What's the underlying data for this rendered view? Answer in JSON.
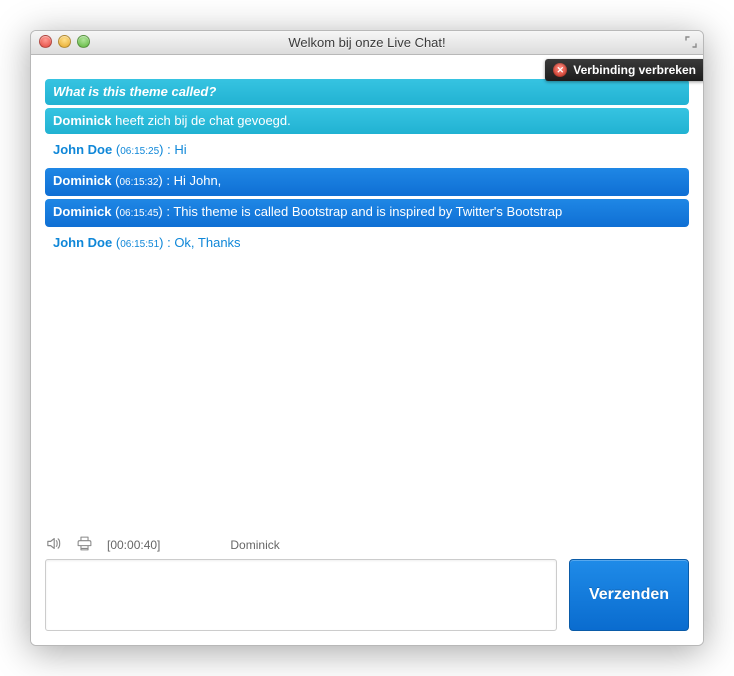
{
  "window": {
    "title": "Welkom bij onze Live Chat!"
  },
  "disconnect": {
    "label": "Verbinding verbreken"
  },
  "chat": {
    "question": "What is this theme called?",
    "joined": {
      "name": "Dominick",
      "rest": " heeft zich bij de chat gevoegd."
    },
    "messages": [
      {
        "kind": "visitor",
        "name": "John Doe",
        "time": "06:15:25",
        "text": "Hi"
      },
      {
        "kind": "agent",
        "name": "Dominick",
        "time": "06:15:32",
        "text": "Hi John,"
      },
      {
        "kind": "agent",
        "name": "Dominick",
        "time": "06:15:45",
        "text": "This theme is called Bootstrap and is inspired by Twitter's Bootstrap"
      },
      {
        "kind": "visitor",
        "name": "John Doe",
        "time": "06:15:51",
        "text": "Ok, Thanks"
      }
    ]
  },
  "status": {
    "duration": "[00:00:40]",
    "typing_name": "Dominick"
  },
  "input": {
    "placeholder": ""
  },
  "send": {
    "label": "Verzenden"
  },
  "colors": {
    "question_bg": "#29bbd9",
    "agent_bg": "#147adc",
    "visitor_fg": "#0f87d8"
  }
}
